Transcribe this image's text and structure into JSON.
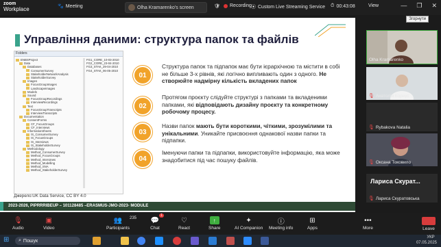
{
  "app": {
    "logo_top": "zoom",
    "logo_bottom": "Workplace"
  },
  "topbar": {
    "meeting_label": "Meeting",
    "share_pill_label": "Olha Kramarenko's screen",
    "recording_label": "Recording",
    "streaming_label": "Custom Live Streaming Service",
    "timer": "00:43:08",
    "view_label": "View",
    "tooltip": "Згорнути"
  },
  "slide": {
    "title": "Управління даними: структура папок та файлів",
    "explorer_header": "Folders",
    "tree": [
      "ENBSProject",
      "Data",
      "Databases",
      "ConsumerSurvey",
      "StakeholderNetworkAnalysis",
      "StakeholderSurvey",
      "Images",
      "FocusGroupImages",
      "LandscapeImages",
      "Models",
      "Sound",
      "FocusGroupRecordings",
      "InterviewRecordings",
      "Text",
      "FocusGroupTranscripts",
      "InterviewTranscripts",
      "Documentation",
      "ConsentForms",
      "CF_FocusGroups",
      "CF_Interviews",
      "InformationSheets",
      "IS_ConsumerSurvey",
      "IS_FocusGroups",
      "IS_Interviews",
      "IS_StakeholderSurvey",
      "Methodology",
      "Method_ConsumerSurvey",
      "Method_FocusGroups",
      "Method_Interviews",
      "Method_Modelling",
      "Method_SNA",
      "Method_StakeholderSurvey"
    ],
    "files": [
      "FG1_CORE_10-03-2010",
      "FG2_CORE_23-04-2010",
      "FG3_STAK_29-04-2010",
      "FG4_STAK_06-05-2010"
    ],
    "caption": "Джерело:UK Data Service, CC BY 4.0",
    "items": [
      {
        "num": "01",
        "text": "Структура папок та підпапок має бути ієрархічною та містити в собі не більше 3-х рівнів, які логічно випливають один з одного. ",
        "bold": "Не створюйте надмірну кількість вкладених папок"
      },
      {
        "num": "02",
        "text": "Протягом проєкту слідуйте структурі з папками та вкладеними папками, які ",
        "bold": "відповідають дизайну проєкту та конкретному робочому процесу."
      },
      {
        "num": "03",
        "text_pre": "Назви папок ",
        "bold": "мають бути короткими, чіткими, зрозумілими та унікальними",
        "text": ". Уникайте присвоєння однакової назви папки та підпапки."
      },
      {
        "num": "04",
        "text": "Іменуючи папки та підпапки, використовуйте інформацію, яка може знадобитися під час пошуку файлів."
      }
    ],
    "footer": "2023-2026, PIPRRRIBEUP – 101128485 –ERASMUS-JMO-2023- MODULE"
  },
  "participants": [
    {
      "name": "Olha Kramarenko"
    },
    {
      "name": "Анатолій Корнус"
    },
    {
      "name": "Rybakova Natalia"
    },
    {
      "name": "Оксана Токовило"
    },
    {
      "name": "Лариса Скуратовська",
      "big": "Лариса  Скурат..."
    }
  ],
  "toolbar": {
    "audio": "Audio",
    "video": "Video",
    "participants": "Participants",
    "participants_count": "235",
    "chat": "Chat",
    "chat_badge": "1",
    "react": "React",
    "share": "Share",
    "ai": "AI Companion",
    "info": "Meeting info",
    "apps": "Apps",
    "more": "More",
    "leave": "Leave"
  },
  "taskbar": {
    "search": "Пошук",
    "lang": "УКР",
    "time": "",
    "date": "07.05.2025"
  },
  "colors": {
    "accent": "#f1a32a",
    "footer": "#2e4a35",
    "title": "#1e1e3c"
  }
}
